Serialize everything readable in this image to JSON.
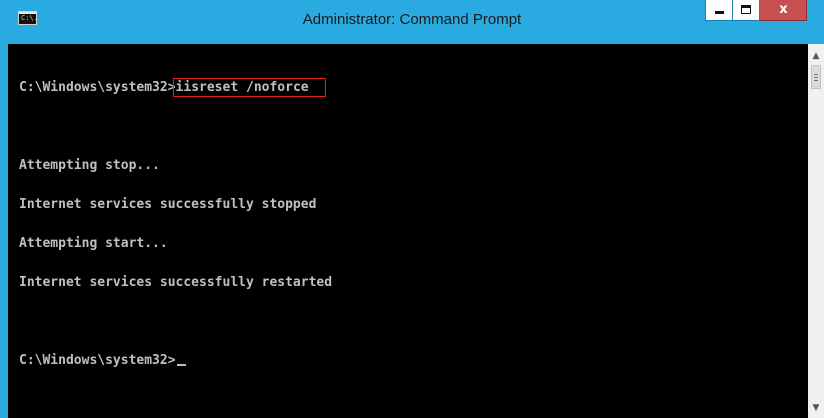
{
  "window": {
    "title": "Administrator: Command Prompt",
    "icon_label": "C:\\.",
    "icon": "command-prompt-icon",
    "controls": {
      "minimize_icon": "minimize-icon",
      "maximize_icon": "maximize-icon",
      "close_glyph": "x"
    }
  },
  "console": {
    "lines": [
      {
        "prompt": "C:\\Windows\\system32>",
        "command": "iisreset /noforce"
      },
      {
        "text": ""
      },
      {
        "text": "Attempting stop..."
      },
      {
        "text": "Internet services successfully stopped"
      },
      {
        "text": "Attempting start..."
      },
      {
        "text": "Internet services successfully restarted"
      },
      {
        "text": ""
      },
      {
        "prompt": "C:\\Windows\\system32>",
        "command": ""
      }
    ]
  },
  "scrollbar": {
    "up_glyph": "^",
    "down_glyph": "v",
    "position": 0
  },
  "colors": {
    "titlebar": "#29abe2",
    "console_background": "#000000",
    "console_text": "#c0c0c0",
    "highlight_box": "#e0201c",
    "close_button": "#c7504f"
  }
}
